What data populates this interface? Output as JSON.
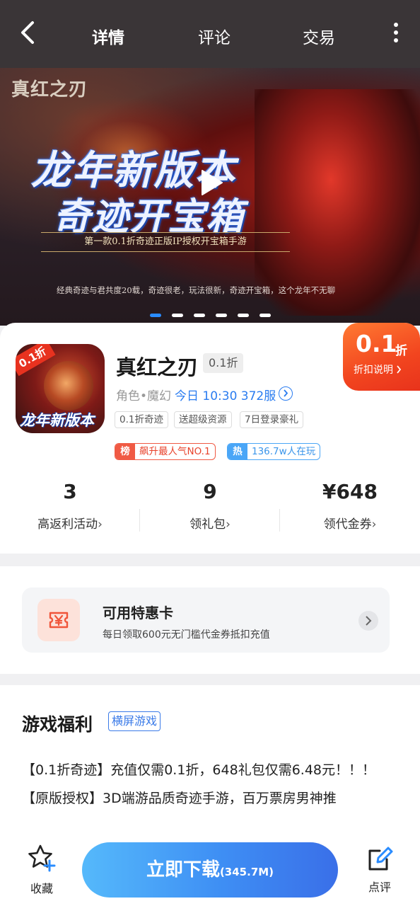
{
  "nav": {
    "tabs": [
      "详情",
      "评论",
      "交易"
    ]
  },
  "banner": {
    "logo_text": "真红之刃",
    "headline_line1": "龙年新版本",
    "headline_line2": "奇迹开宝箱",
    "subline": "第一款0.1折奇迹正版IP授权开宝箱手游",
    "footline": "经典奇迹与君共度20载，奇迹很老，玩法很新，奇迹开宝箱，这个龙年不无聊",
    "slide_count": 6,
    "active_slide": 1
  },
  "app": {
    "icon_corner": "0.1折",
    "icon_text": "龙年新版本",
    "name": "真红之刃",
    "name_badge": "0.1折",
    "genre": "角色•魔幻",
    "server": "今日 10:30 372服",
    "tags": [
      "0.1折奇迹",
      "送超级资源",
      "7日登录豪礼"
    ],
    "rank_badge": "榜",
    "rank_text": "飙升最人气NO.1",
    "hot_badge": "热",
    "hot_text": "136.7w人在玩"
  },
  "discount": {
    "value": "0.1",
    "unit": "折",
    "note": "折扣说明"
  },
  "stats": [
    {
      "value": "3",
      "label": "高返利活动"
    },
    {
      "value": "9",
      "label": "领礼包"
    },
    {
      "value": "¥648",
      "label": "领代金券"
    }
  ],
  "promo": {
    "title": "可用特惠卡",
    "subtitle": "每日领取600元无门槛代金券抵扣充值"
  },
  "welfare": {
    "title": "游戏福利",
    "tag": "横屏游戏",
    "line1": "【0.1折奇迹】充值仅需0.1折，648礼包仅需6.48元！！！",
    "line2": "【原版授权】3D端游品质奇迹手游，百万票房男神推"
  },
  "bottom": {
    "favorite_label": "收藏",
    "download_label": "立即下载",
    "download_size": "(345.7M)",
    "review_label": "点评"
  },
  "colors": {
    "accent_blue": "#2a7cf0",
    "discount_orange": "#f2451f",
    "top_bar": "#3a3537"
  }
}
